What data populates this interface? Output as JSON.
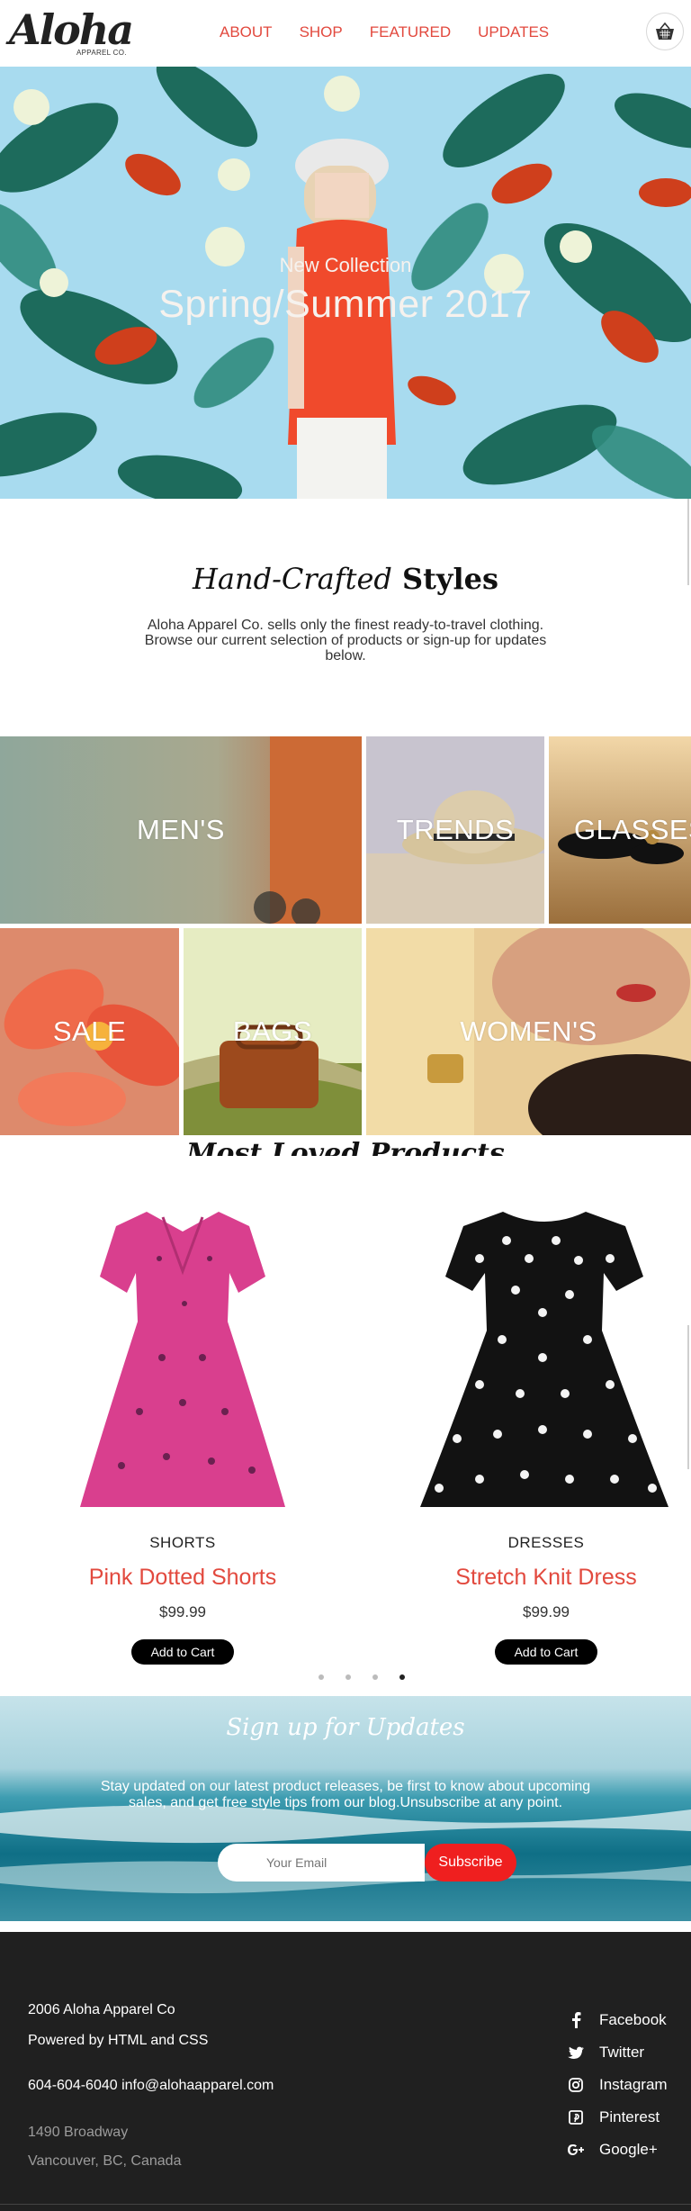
{
  "brand": {
    "logo_script": "Aloha",
    "logo_sub": "APPAREL CO."
  },
  "nav": {
    "items": [
      "ABOUT",
      "SHOP",
      "FEATURED",
      "UPDATES"
    ]
  },
  "hero": {
    "subtitle": "New Collection",
    "title": "Spring/Summer 2017"
  },
  "intro": {
    "title_italic": "Hand-Crafted",
    "title_bold": "Styles",
    "text": "Aloha Apparel Co. sells only the finest ready-to-travel clothing. Browse our current selection of products or sign-up for updates below."
  },
  "categories": [
    "MEN'S",
    "TRENDS",
    "GLASSES",
    "SALE",
    "BAGS",
    "WOMEN'S"
  ],
  "products_heading": "Most Loved Products",
  "products": [
    {
      "category": "SHORTS",
      "name": "Pink Dotted Shorts",
      "price": "$99.99",
      "button": "Add to Cart"
    },
    {
      "category": "DRESSES",
      "name": "Stretch Knit Dress",
      "price": "$99.99",
      "button": "Add to Cart"
    }
  ],
  "carousel": {
    "count": 4,
    "active": 4
  },
  "signup": {
    "title": "Sign up for Updates",
    "text": "Stay updated on our latest product releases, be first to know about upcoming sales, and get free style tips from our blog.Unsubscribe at any point.",
    "email_placeholder": "Your Email",
    "button": "Subscribe"
  },
  "footer": {
    "line1": "2006 Aloha Apparel Co",
    "line2": "Powered by HTML and CSS",
    "contact": "604-604-6040 info@alohaapparel.com",
    "address1": "1490 Broadway",
    "address2": "Vancouver, BC, Canada",
    "social": [
      "Facebook",
      "Twitter",
      "Instagram",
      "Pinterest",
      "Google+"
    ]
  },
  "colors": {
    "accent": "#e2493e",
    "subscribe": "#ef1f1f",
    "footer_bg": "#202020"
  }
}
